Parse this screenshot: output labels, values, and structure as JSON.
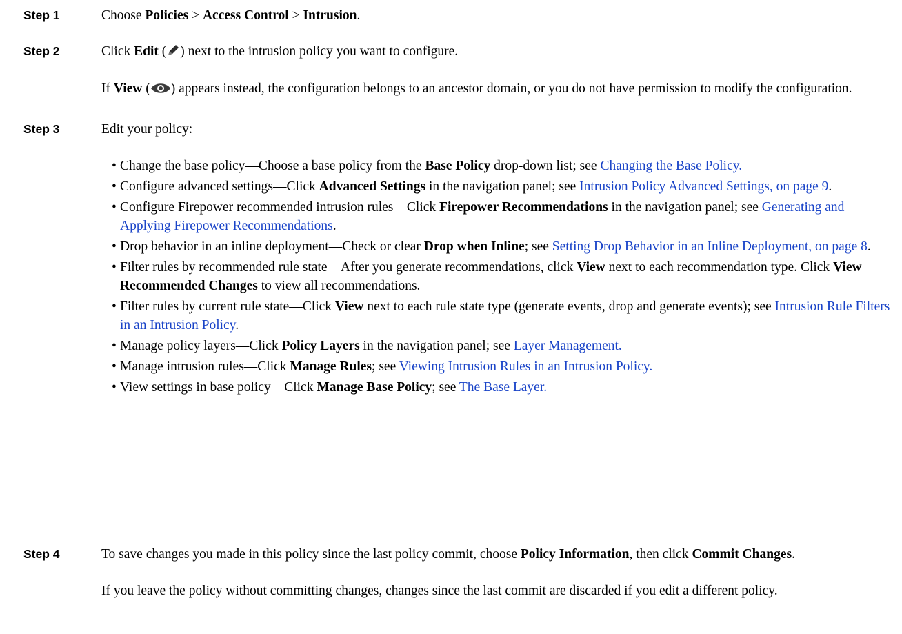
{
  "steps": [
    {
      "label": "Step 1",
      "para": [
        {
          "t": "Choose "
        },
        {
          "t": "Policies",
          "b": true
        },
        {
          "t": " > "
        },
        {
          "t": "Access Control",
          "b": true
        },
        {
          "t": " > "
        },
        {
          "t": "Intrusion",
          "b": true
        },
        {
          "t": "."
        }
      ]
    },
    {
      "label": "Step 2",
      "para": [
        {
          "t": "Click "
        },
        {
          "t": "Edit",
          "b": true
        },
        {
          "t": " ("
        },
        {
          "icon": "pencil-icon"
        },
        {
          "t": ") next to the intrusion policy you want to configure."
        }
      ],
      "para2": [
        {
          "t": "If "
        },
        {
          "t": "View",
          "b": true
        },
        {
          "t": " ("
        },
        {
          "icon": "eye-icon"
        },
        {
          "t": ") appears instead, the configuration belongs to an ancestor domain, or you do not have permission to modify the configuration."
        }
      ]
    },
    {
      "label": "Step 3",
      "para": [
        {
          "t": "Edit your policy:"
        }
      ],
      "bullets": [
        [
          {
            "t": "Change the base policy—Choose a base policy from the "
          },
          {
            "t": "Base Policy",
            "b": true
          },
          {
            "t": " drop-down list; see "
          },
          {
            "t": "Changing the Base Policy.",
            "link": true
          }
        ],
        [
          {
            "t": "Configure advanced settings—Click "
          },
          {
            "t": "Advanced Settings",
            "b": true
          },
          {
            "t": " in the navigation panel; see "
          },
          {
            "t": "Intrusion Policy Advanced Settings, on page 9",
            "link": true
          },
          {
            "t": "."
          }
        ],
        [
          {
            "t": "Configure Firepower recommended intrusion rules—Click "
          },
          {
            "t": "Firepower Recommendations",
            "b": true
          },
          {
            "t": " in the navigation panel; see "
          },
          {
            "t": "Generating and Applying Firepower Recommendations",
            "link": true
          },
          {
            "t": "."
          }
        ],
        [
          {
            "t": "Drop behavior in an inline deployment—Check or clear "
          },
          {
            "t": "Drop when Inline",
            "b": true
          },
          {
            "t": "; see "
          },
          {
            "t": "Setting Drop Behavior in an Inline Deployment, on page 8",
            "link": true
          },
          {
            "t": "."
          }
        ],
        [
          {
            "t": "Filter rules by recommended rule state—After you generate recommendations, click "
          },
          {
            "t": "View",
            "b": true
          },
          {
            "t": " next to each recommendation type. Click "
          },
          {
            "t": "View Recommended Changes",
            "b": true
          },
          {
            "t": " to view all recommendations."
          }
        ],
        [
          {
            "t": "Filter rules by current rule state—Click "
          },
          {
            "t": "View",
            "b": true
          },
          {
            "t": " next to each rule state type (generate events, drop and generate events); see "
          },
          {
            "t": "Intrusion Rule Filters in an Intrusion Policy",
            "link": true
          },
          {
            "t": "."
          }
        ],
        [
          {
            "t": "Manage policy layers—Click "
          },
          {
            "t": "Policy Layers",
            "b": true
          },
          {
            "t": " in the navigation panel; see "
          },
          {
            "t": "Layer Management.",
            "link": true
          }
        ],
        [
          {
            "t": "Manage intrusion rules—Click "
          },
          {
            "t": "Manage Rules",
            "b": true
          },
          {
            "t": "; see "
          },
          {
            "t": "Viewing Intrusion Rules in an Intrusion Policy.",
            "link": true
          }
        ],
        [
          {
            "t": "View settings in base policy—Click "
          },
          {
            "t": "Manage Base Policy",
            "b": true
          },
          {
            "t": "; see "
          },
          {
            "t": "The Base Layer.",
            "link": true
          }
        ]
      ]
    },
    {
      "label": "Step 4",
      "para": [
        {
          "t": "To save changes you made in this policy since the last policy commit, choose "
        },
        {
          "t": "Policy Information",
          "b": true
        },
        {
          "t": ", then click "
        },
        {
          "t": "Commit Changes",
          "b": true
        },
        {
          "t": "."
        }
      ],
      "para2": [
        {
          "t": "If you leave the policy without committing changes, changes since the last commit are discarded if you edit a different policy."
        }
      ]
    }
  ],
  "bullet_char": "•",
  "colors": {
    "link": "#1a44c8",
    "text": "#000000",
    "background": "#ffffff"
  }
}
